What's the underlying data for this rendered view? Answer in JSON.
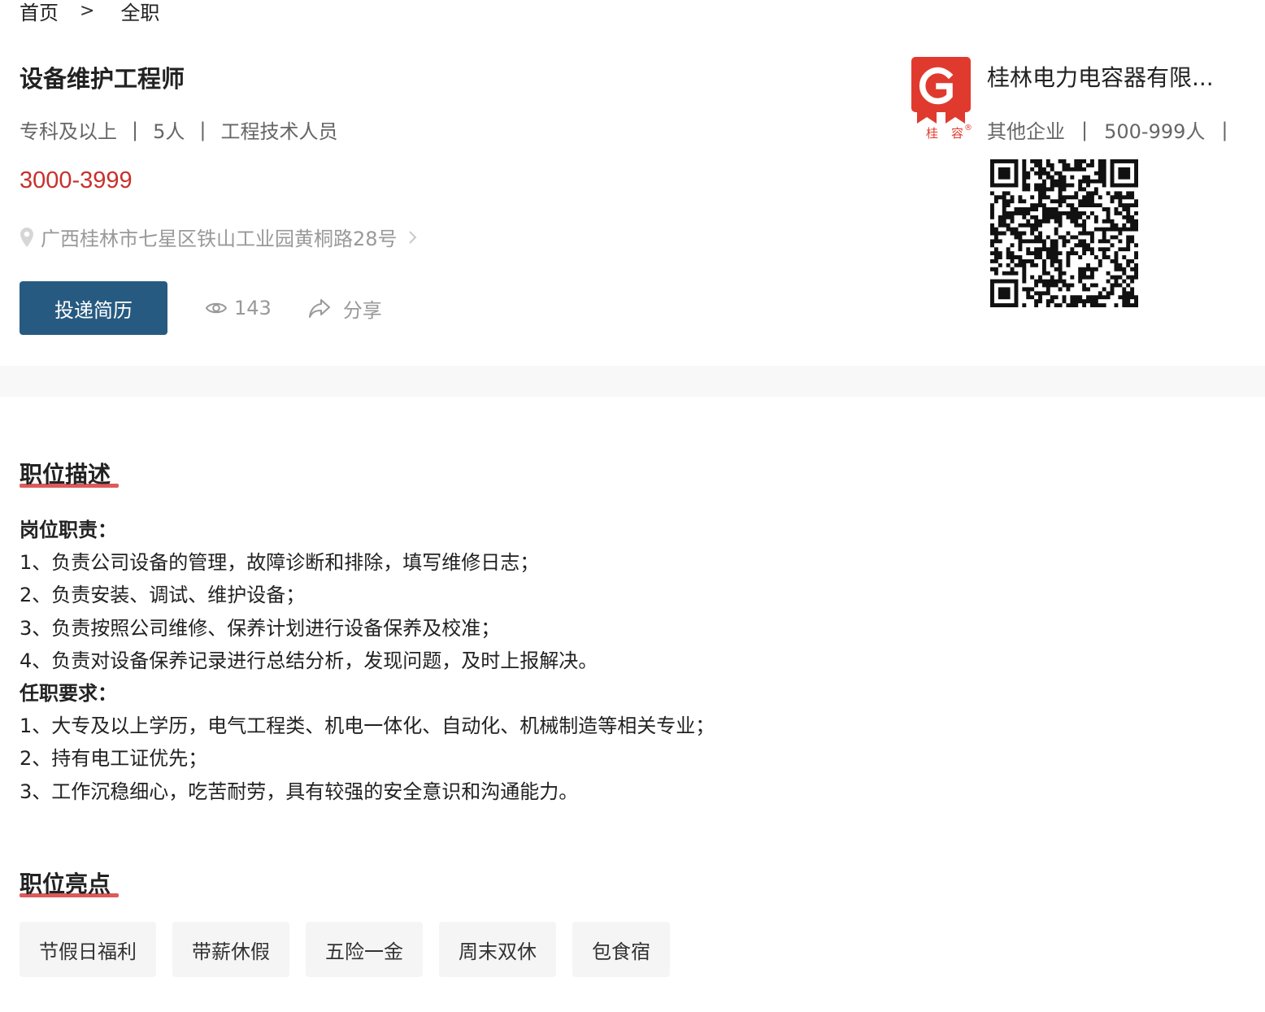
{
  "breadcrumb": {
    "home": "首页",
    "separator": ">",
    "current": "全职"
  },
  "job": {
    "title": "设备维护工程师",
    "education": "专科及以上",
    "headcount": "5人",
    "category": "工程技术人员",
    "meta_divider": "|",
    "salary": "3000-3999",
    "address": "广西桂林市七星区铁山工业园黄桐路28号",
    "apply_label": "投递简历",
    "views": "143",
    "share_label": "分享"
  },
  "company": {
    "name": "桂林电力电容器有限...",
    "type": "其他企业",
    "size": "500-999人",
    "meta_divider": "|",
    "logo": {
      "letter": "G",
      "chars": [
        "桂",
        "容"
      ],
      "registered": "®",
      "color": "#e03a2f"
    }
  },
  "description": {
    "section_title": "职位描述",
    "duties_heading": "岗位职责：",
    "duties": [
      "1、负责公司设备的管理，故障诊断和排除，填写维修日志；",
      "2、负责安装、调试、维护设备；",
      "3、负责按照公司维修、保养计划进行设备保养及校准；",
      "4、负责对设备保养记录进行总结分析，发现问题，及时上报解决。"
    ],
    "requirements_heading": "任职要求：",
    "requirements": [
      "1、大专及以上学历，电气工程类、机电一体化、自动化、机械制造等相关专业；",
      "2、持有电工证优先；",
      "3、工作沉稳细心，吃苦耐劳，具有较强的安全意识和沟通能力。"
    ]
  },
  "highlights": {
    "section_title": "职位亮点",
    "tags": [
      "节假日福利",
      "带薪休假",
      "五险一金",
      "周末双休",
      "包食宿"
    ]
  },
  "colors": {
    "salary": "#c8312c",
    "primary_button": "#275a80",
    "accent_underline": "#d94848",
    "muted_text": "#999999"
  },
  "icons": {
    "location": "location-pin-icon",
    "chevron": "chevron-right-icon",
    "views": "eye-icon",
    "share": "share-arrow-icon",
    "qr": "qr-code"
  }
}
